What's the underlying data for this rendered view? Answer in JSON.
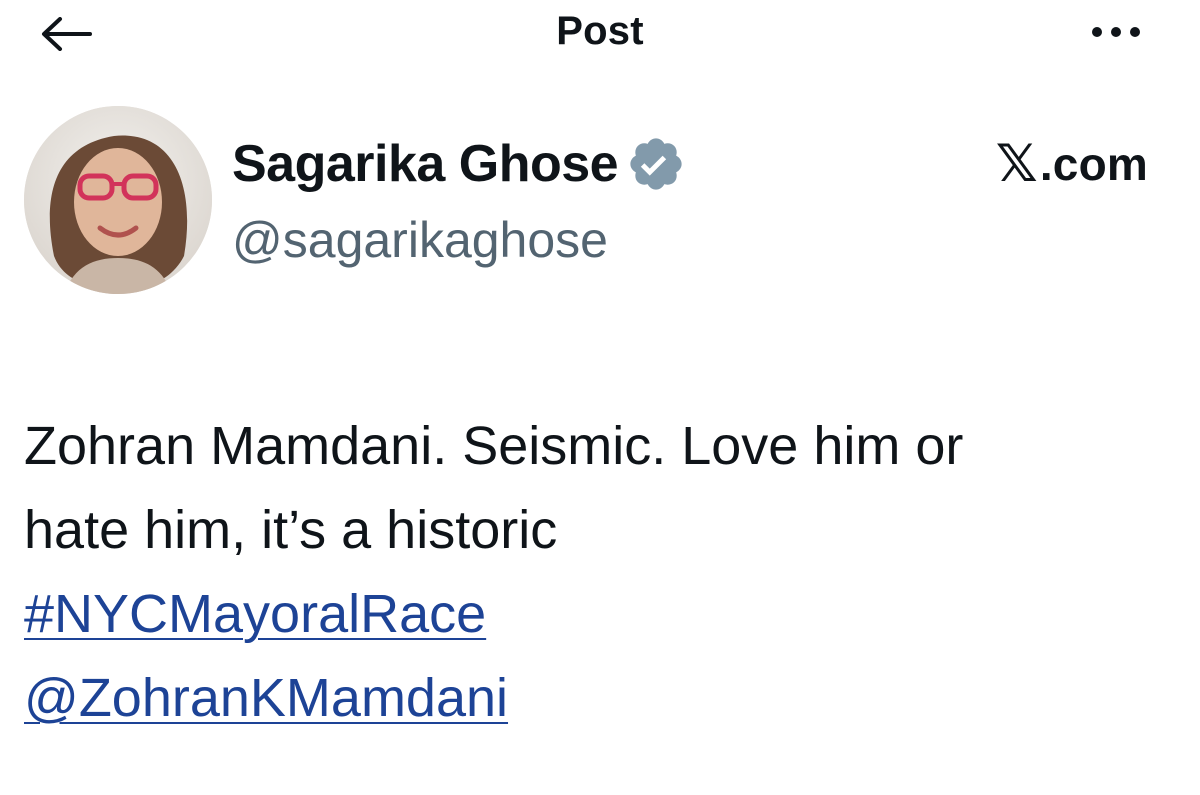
{
  "header": {
    "title": "Post",
    "back_icon": "arrow-left-icon",
    "more_icon": "more-horizontal-icon"
  },
  "author": {
    "name": "Sagarika Ghose",
    "handle": "@sagarikaghose",
    "verified_icon": "verified-badge-icon",
    "verified_color": "#829aab"
  },
  "source": {
    "logo_glyph": "𝕏",
    "label": ".com"
  },
  "post": {
    "text_line_1": "Zohran Mamdani. Seismic. Love him or",
    "text_line_2": "hate him, it’s a historic",
    "hashtag": "#NYCMayoralRace",
    "mention": "@ZohranKMamdani",
    "link_color": "#1d4396"
  }
}
